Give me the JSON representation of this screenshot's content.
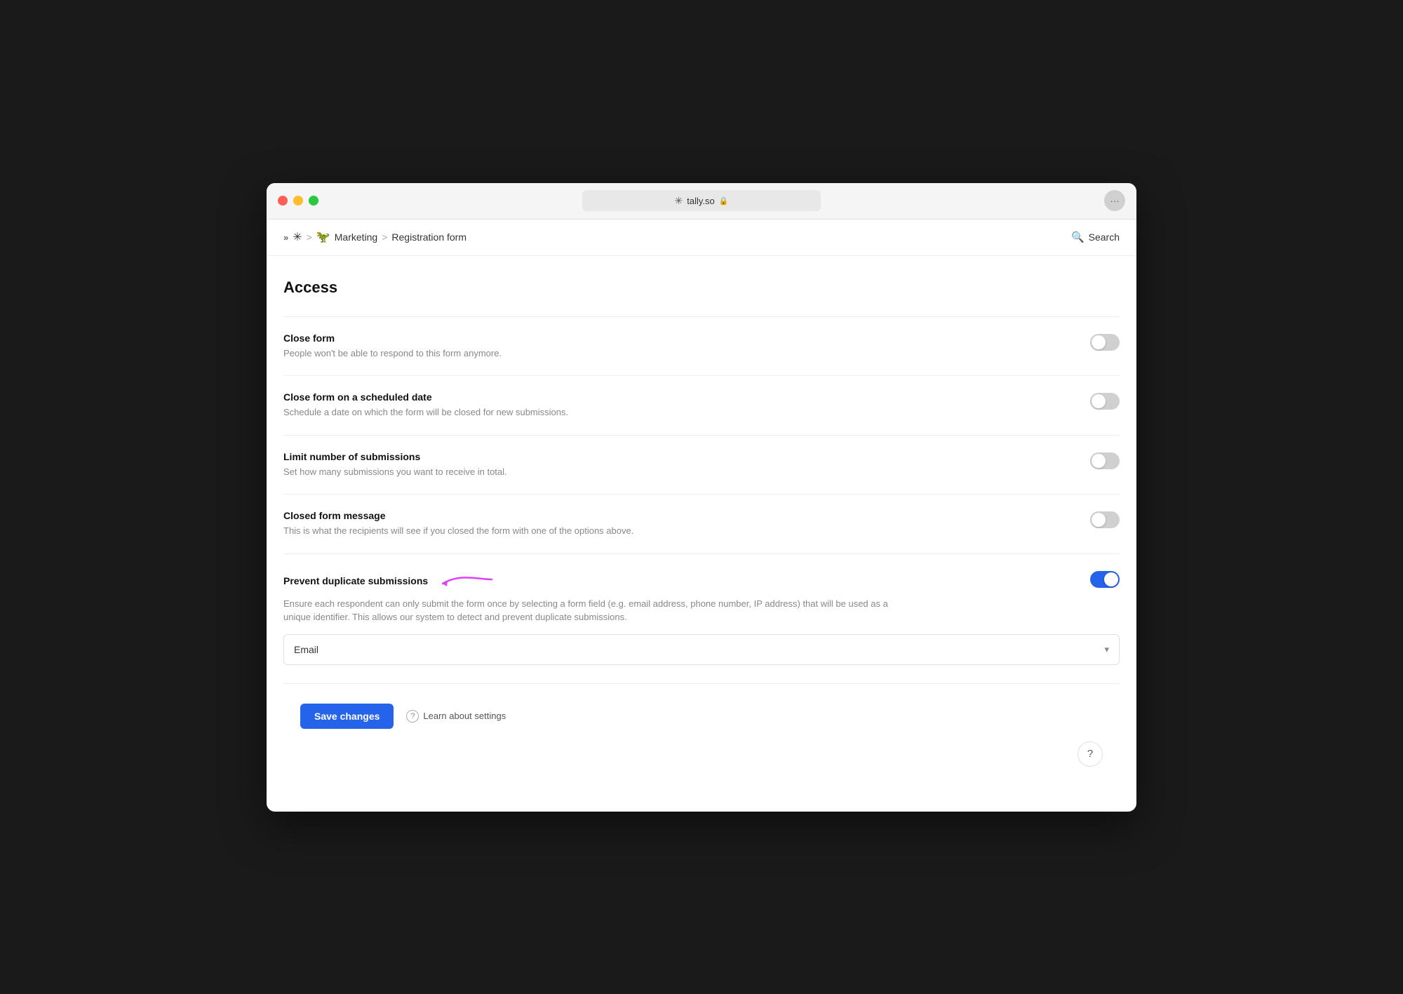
{
  "window": {
    "titlebar": {
      "url": "tally.so",
      "lock_icon": "🔒",
      "menu_icon": "···"
    }
  },
  "navbar": {
    "breadcrumb": {
      "nav_icon": "»",
      "tally_icon": "✳",
      "workspace_icon": "🦖",
      "workspace": "Marketing",
      "separator1": ">",
      "separator2": ">",
      "current": "Registration form"
    },
    "search_label": "Search"
  },
  "page": {
    "title": "Access",
    "settings": [
      {
        "id": "close-form",
        "title": "Close form",
        "description": "People won't be able to respond to this form anymore.",
        "enabled": false
      },
      {
        "id": "close-form-scheduled",
        "title": "Close form on a scheduled date",
        "description": "Schedule a date on which the form will be closed for new submissions.",
        "enabled": false
      },
      {
        "id": "limit-submissions",
        "title": "Limit number of submissions",
        "description": "Set how many submissions you want to receive in total.",
        "enabled": false
      },
      {
        "id": "closed-form-message",
        "title": "Closed form message",
        "description": "This is what the recipients will see if you closed the form with one of the options above.",
        "enabled": false
      }
    ],
    "duplicate_setting": {
      "title": "Prevent duplicate submissions",
      "description": "Ensure each respondent can only submit the form once by selecting a form field (e.g. email address, phone number, IP address) that will be used as a unique identifier. This allows our system to detect and prevent duplicate submissions.",
      "enabled": true,
      "dropdown": {
        "value": "Email",
        "placeholder": "Email"
      }
    },
    "footer": {
      "save_label": "Save changes",
      "learn_label": "Learn about settings"
    },
    "help_btn": "?"
  }
}
